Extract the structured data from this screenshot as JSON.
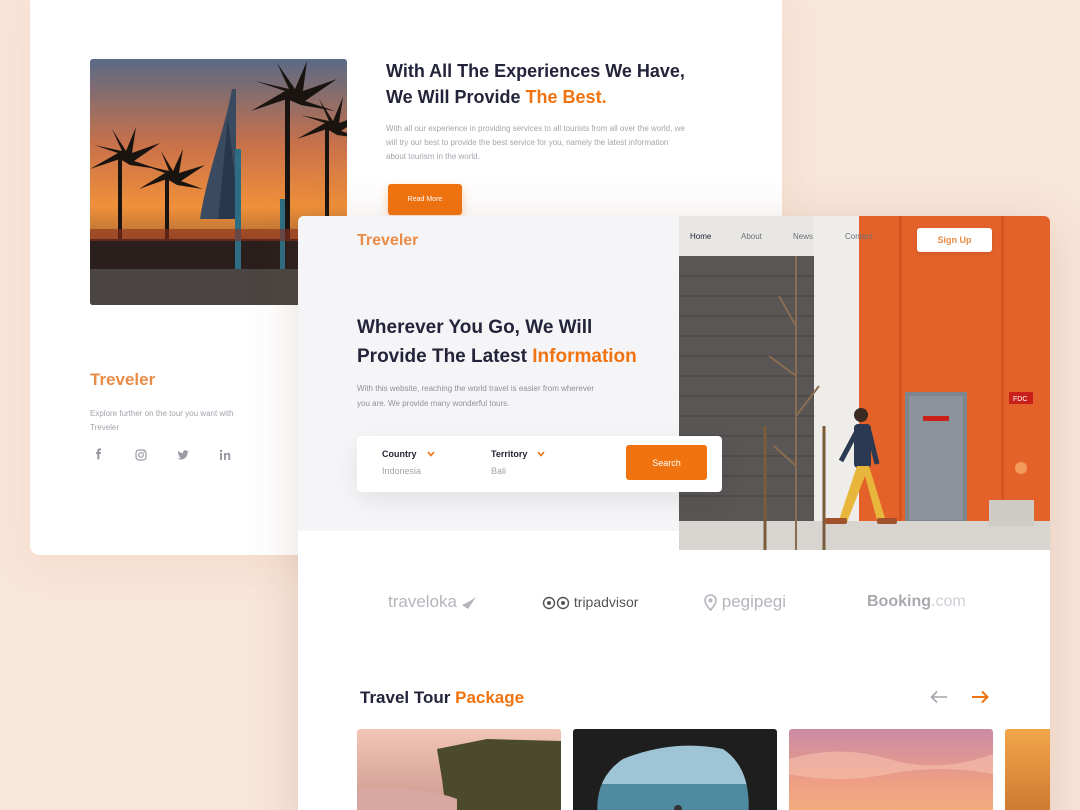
{
  "about": {
    "heading_line1": "With All The Experiences We Have,",
    "heading_line2_prefix": "We Will Provide ",
    "heading_accent": "The Best.",
    "paragraph": "With all our experience in providing services to all tourists from all over the world, we will try our best to provide the best service for you, namely the latest information about tourism in the world.",
    "read_more_label": "Read More",
    "image_icon": "burj-al-arab-sunset-photo"
  },
  "footer": {
    "logo": "Treveler",
    "tagline": "Explore further on the tour you want with Treveler",
    "socials": [
      "facebook-icon",
      "instagram-icon",
      "twitter-icon",
      "linkedin-icon"
    ]
  },
  "header": {
    "logo": "Treveler",
    "nav": [
      "Home",
      "About",
      "News",
      "Contact"
    ],
    "active_nav": "Home",
    "signup_label": "Sign Up"
  },
  "hero": {
    "title_line1": "Wherever You Go, We Will",
    "title_line2_prefix": "Provide The Latest ",
    "title_accent": "Information",
    "subtitle": "With this website, reaching the world travel is easier from wherever you are. We provide many wonderful tours.",
    "image_icon": "man-walking-orange-building-photo"
  },
  "search": {
    "country_label": "Country",
    "country_value": "Indonesia",
    "territory_label": "Territory",
    "territory_value": "Bali",
    "button_label": "Search"
  },
  "partners": [
    "traveloka",
    "tripadvisor",
    "pegipegi",
    "Booking",
    ".com"
  ],
  "packages": {
    "title_prefix": "Travel Tour ",
    "title_accent": "Package",
    "cards": [
      "cliff-sunset-photo",
      "sea-cave-photo",
      "pink-sky-photo",
      "sunset-photo"
    ]
  },
  "colors": {
    "accent": "#f1730f",
    "logo": "#e98c48",
    "background": "#f9e6da",
    "text": "#23243a"
  }
}
